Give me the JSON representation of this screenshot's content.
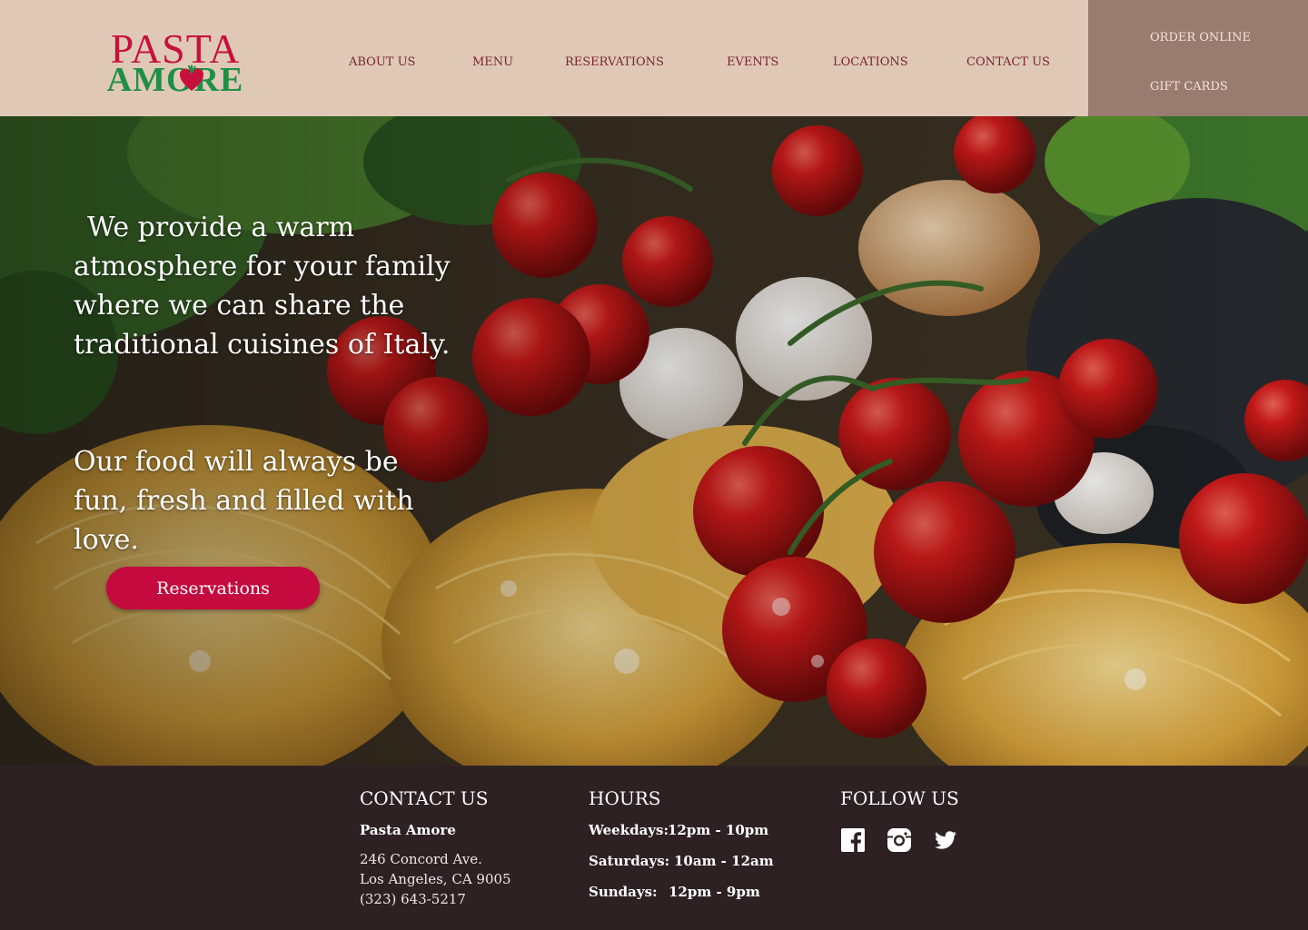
{
  "logo": {
    "line1": "PASTA",
    "line2": "AMORE"
  },
  "nav": [
    {
      "label": "ABOUT US"
    },
    {
      "label": "MENU"
    },
    {
      "label": "RESERVATIONS"
    },
    {
      "label": "EVENTS"
    },
    {
      "label": "LOCATIONS"
    },
    {
      "label": "CONTACT US"
    }
  ],
  "side_panel": {
    "order_online": "ORDER ONLINE",
    "gift_cards": "GIFT CARDS"
  },
  "hero": {
    "paragraph1": [
      "We provide a warm",
      "atmosphere for your family",
      "where we  can share the",
      "traditional cuisines of Italy."
    ],
    "paragraph2": [
      "Our food will  always be",
      "fun, fresh and filled with",
      "love."
    ],
    "button_label": "Reservations"
  },
  "footer": {
    "contact": {
      "heading": "CONTACT US",
      "name": "Pasta Amore",
      "address1": "246 Concord Ave.",
      "address2": "Los Angeles, CA 9005",
      "phone": "(323) 643-5217"
    },
    "hours": {
      "heading": "HOURS",
      "rows": [
        {
          "day": "Weekdays:",
          "time": "12pm - 10pm"
        },
        {
          "day": "Saturdays:",
          "time": "10am - 12am"
        },
        {
          "day": "Sundays:",
          "time": "12pm - 9pm"
        }
      ]
    },
    "follow": {
      "heading": "FOLLOW US",
      "icons": [
        "facebook-icon",
        "instagram-icon",
        "twitter-icon"
      ]
    }
  },
  "colors": {
    "header_bg": "#dfc9b6",
    "side_panel_bg": "#9a7b6f",
    "nav_text": "#7b2334",
    "brand_red": "#c8103f",
    "brand_green": "#1f8f45",
    "button": "#c40a3e",
    "footer_bg": "#2e2123"
  }
}
